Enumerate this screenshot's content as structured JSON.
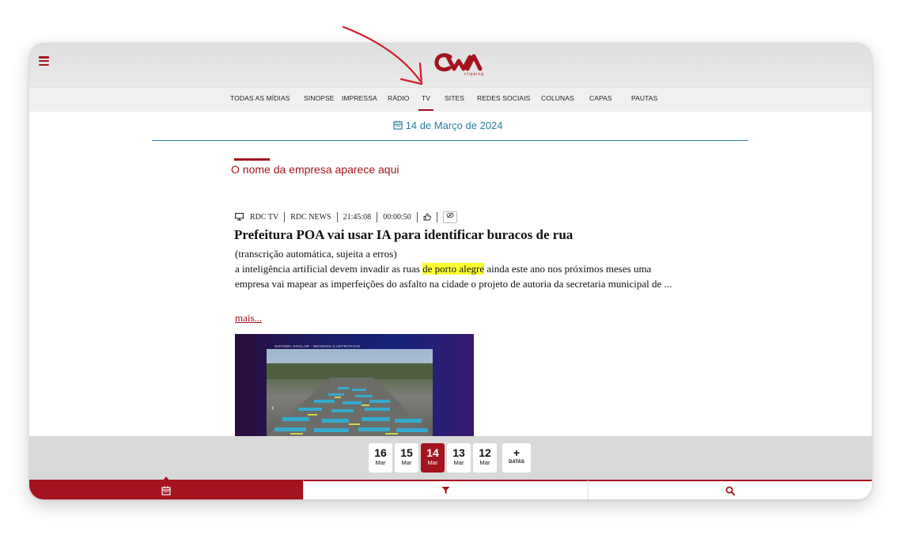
{
  "brand": {
    "logo_text": "CWA",
    "logo_sub": "clipping",
    "accent": "#a3141e",
    "link_color": "#2a7fa0"
  },
  "header": {
    "menu_icon": "hamburger-icon"
  },
  "nav": {
    "items": [
      "TODAS AS MÍDIAS",
      "SINOPSE",
      "IMPRESSA",
      "RÁDIO",
      "TV",
      "SITES",
      "REDES SOCIAIS",
      "COLUNAS",
      "CAPAS",
      "PAUTAS"
    ],
    "active": "TV"
  },
  "date_header": {
    "icon": "calendar-icon",
    "text": "14 de Março de 2024"
  },
  "company": {
    "name": "O nome da empresa aparece aqui"
  },
  "article": {
    "media_icon": "monitor-icon",
    "station": "RDC TV",
    "program": "RDC NEWS",
    "time": "21:45:08",
    "duration": "00:00:50",
    "like_icon": "thumbs-up-icon",
    "eye_icon": "eye-off-icon",
    "title": "Prefeitura POA vai usar IA para identificar buracos de rua",
    "subtitle": "(transcrição automática, sujeita a erros)",
    "body_before": "a inteligência artificial devem invadir as ruas ",
    "body_highlight": "de porto alegre",
    "body_after": " ainda este ano nos próximos meses uma empresa vai mapear as imperfeições do asfalto na cidade o projeto de autoria da secretaria municipal de ...",
    "more_label": "mais...",
    "video_caption": "SISTEMA SIVALAR · IMAGENS ILUSTRATIVAS"
  },
  "dates": [
    {
      "day": "16",
      "month": "Mar"
    },
    {
      "day": "15",
      "month": "Mar"
    },
    {
      "day": "14",
      "month": "Mar"
    },
    {
      "day": "13",
      "month": "Mar"
    },
    {
      "day": "12",
      "month": "Mar"
    }
  ],
  "active_date": "14",
  "more_dates": {
    "plus": "+",
    "label": "DATAS"
  },
  "bottom_tabs": [
    {
      "icon": "calendar-icon",
      "active": true
    },
    {
      "icon": "filter-icon",
      "active": false
    },
    {
      "icon": "search-icon",
      "active": false
    }
  ]
}
